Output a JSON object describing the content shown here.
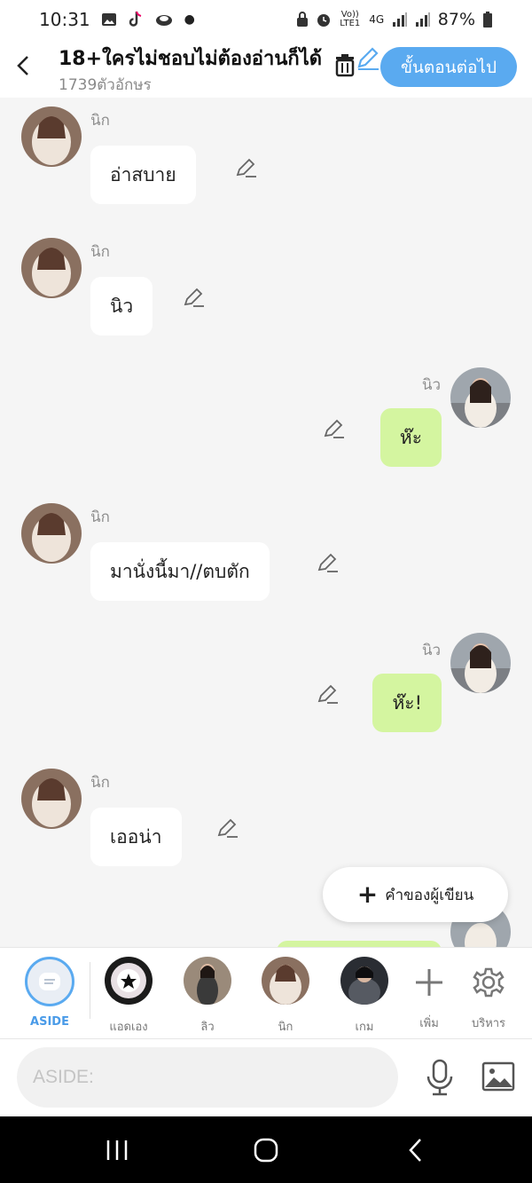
{
  "status_bar": {
    "time": "10:31",
    "battery": "87%",
    "network_label": "Vo)) LTE1",
    "net_4g": "4G"
  },
  "header": {
    "title": "18+ใครไม่ชอบไม่ต้องอ่านก็ได้",
    "subtitle": "1739ตัวอักษร",
    "next_label": "ขั้นตอนต่อไป"
  },
  "messages": [
    {
      "side": "left",
      "sender": "นิก",
      "text": "อ่าสบาย"
    },
    {
      "side": "left",
      "sender": "นิก",
      "text": "นิว"
    },
    {
      "side": "right",
      "sender": "นิว",
      "text": "ห๊ะ"
    },
    {
      "side": "left",
      "sender": "นิก",
      "text": "มานั่งนี้มา//ตบตัก"
    },
    {
      "side": "right",
      "sender": "นิว",
      "text": "ห๊ะ!"
    },
    {
      "side": "left",
      "sender": "นิก",
      "text": "เออน่า"
    }
  ],
  "fab": {
    "label": "คำของผู้เขียน"
  },
  "characters": [
    {
      "label": "ASIDE"
    },
    {
      "label": "แอดเอง"
    },
    {
      "label": "ลิว"
    },
    {
      "label": "นิก"
    },
    {
      "label": "เกม"
    },
    {
      "label": "เพิ่ม"
    },
    {
      "label": "บริหาร"
    }
  ],
  "input": {
    "placeholder": "ASIDE:"
  },
  "colors": {
    "accent": "#5aaaf0",
    "right_bubble": "#d4f5a0",
    "left_bubble": "#ffffff",
    "background": "#f5f5f5"
  }
}
